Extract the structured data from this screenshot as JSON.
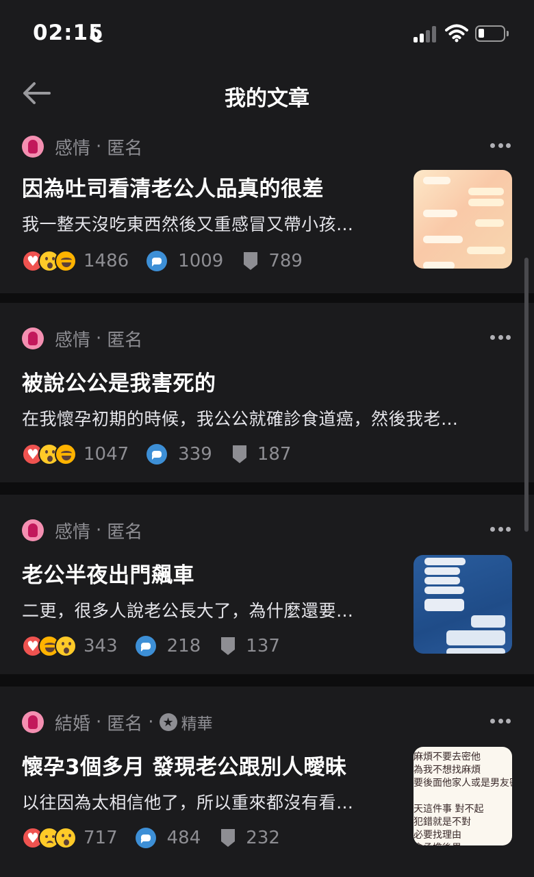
{
  "status_bar": {
    "time": "02:15",
    "icons": [
      "moon-icon",
      "signal-icon",
      "wifi-icon",
      "battery-icon"
    ]
  },
  "header": {
    "title": "我的文章",
    "back_icon": "arrow-left-icon"
  },
  "colors": {
    "background": "#0d0d0e",
    "card": "#1b1b1d",
    "meta": "#8e8e93",
    "comment_blue": "#3d8fd6",
    "avatar_pink": "#f48fb1"
  },
  "posts": [
    {
      "board": "感情",
      "author": "匿名",
      "title": "因為吐司看清老公人品真的很差",
      "excerpt": "我一整天沒吃東西然後又重感冒又帶小孩…",
      "reactions": [
        "heart",
        "wow",
        "lol"
      ],
      "likes": "1486",
      "comments": "1009",
      "saves": "789",
      "has_thumbnail": true
    },
    {
      "board": "感情",
      "author": "匿名",
      "title": "被說公公是我害死的",
      "excerpt": "在我懷孕初期的時候，我公公就確診食道癌，然後我老…",
      "reactions": [
        "heart",
        "wow",
        "lol"
      ],
      "likes": "1047",
      "comments": "339",
      "saves": "187",
      "has_thumbnail": false
    },
    {
      "board": "感情",
      "author": "匿名",
      "title": "老公半夜出門飆車",
      "excerpt": "二更，很多人說老公長大了，為什麼還要…",
      "reactions": [
        "heart",
        "lol",
        "wow"
      ],
      "likes": "343",
      "comments": "218",
      "saves": "137",
      "has_thumbnail": true
    },
    {
      "board": "結婚",
      "author": "匿名",
      "featured": "精華",
      "title": "懷孕3個多月 發現老公跟別人曖昧",
      "excerpt": "以往因為太相信他了，所以重來都沒有看…",
      "reactions": [
        "heart",
        "sad",
        "wow"
      ],
      "likes": "717",
      "comments": "484",
      "saves": "232",
      "has_thumbnail": true,
      "thumbnail_text": "麻煩不要去密他\n為我不想找麻煩\n要後面他家人或是男友密我\n\n天這件事 對不起\n犯錯就是不對\n必要找理由\n會承擔後果\n後我不會在密他 封鎖他"
    }
  ]
}
